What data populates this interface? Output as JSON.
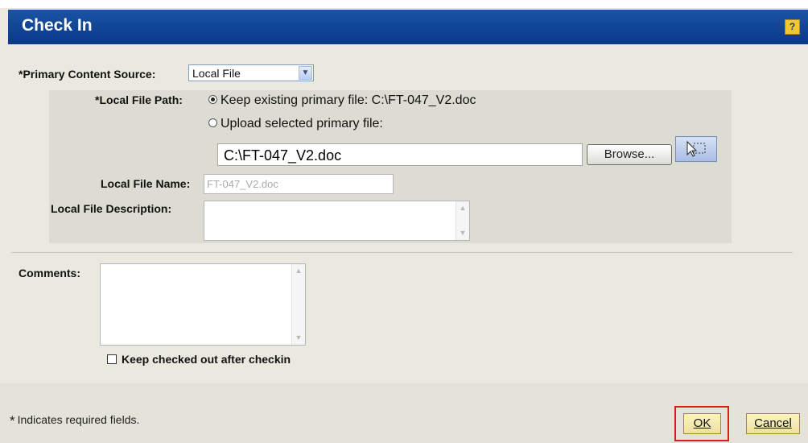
{
  "dialog": {
    "title": "Check In",
    "help_label": "?"
  },
  "form": {
    "primary_source_label": "*Primary Content Source:",
    "primary_source_value": "Local File",
    "local_file_path_label": "*Local File Path:",
    "keep_existing_option": "Keep existing primary file: C:\\FT-047_V2.doc",
    "keep_existing_selected": true,
    "upload_option": "Upload selected primary file:",
    "upload_selected": false,
    "file_path_value": "C:\\FT-047_V2.doc",
    "browse_label": "Browse...",
    "local_file_name_label": "Local File Name:",
    "local_file_name_value": "FT-047_V2.doc",
    "local_file_description_label": "Local File Description:",
    "local_file_description_value": "",
    "comments_label": "Comments:",
    "comments_value": "",
    "keep_checked_out_label": "Keep checked out after checkin",
    "keep_checked_out_checked": false
  },
  "footer": {
    "required_star": "*",
    "required_note": "Indicates required fields.",
    "ok_label": "OK",
    "cancel_label": "Cancel"
  },
  "icons": {
    "dropdown": "chevron-down-icon",
    "drag_drop": "drag-drop-icon",
    "scroll_up": "scroll-up-icon",
    "scroll_down": "scroll-down-icon"
  },
  "colors": {
    "titlebar": "#08388a",
    "button_fill": "#ede0a0",
    "ok_highlight": "#d91c1c",
    "panel": "#eae9e0"
  }
}
